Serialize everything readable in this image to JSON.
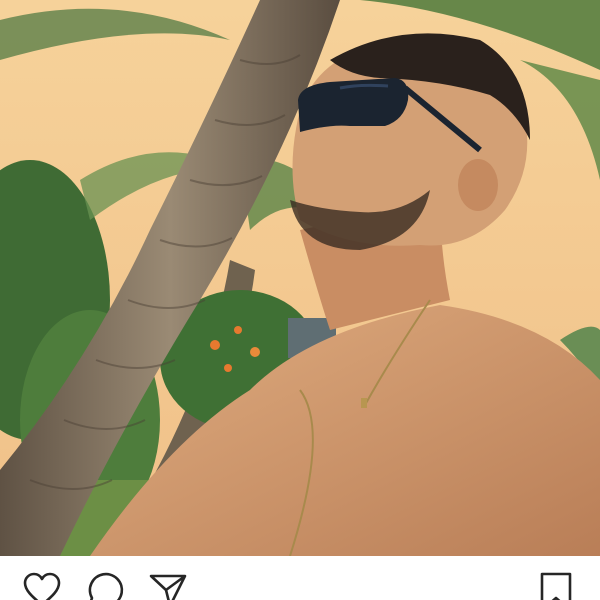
{
  "post": {
    "photo": {
      "subject": "photo",
      "palette": {
        "sky": "#f2c98f",
        "trunk": "#7d6a55",
        "foliage": "#4a7a3a",
        "skin": "#d39a6e",
        "glasses": "#1b2430"
      }
    },
    "actions": {
      "like_icon": "heart-icon",
      "comment_icon": "comment-icon",
      "share_icon": "send-icon",
      "save_icon": "bookmark-icon"
    },
    "colors": {
      "icon_stroke": "#262626",
      "background": "#ffffff"
    }
  }
}
